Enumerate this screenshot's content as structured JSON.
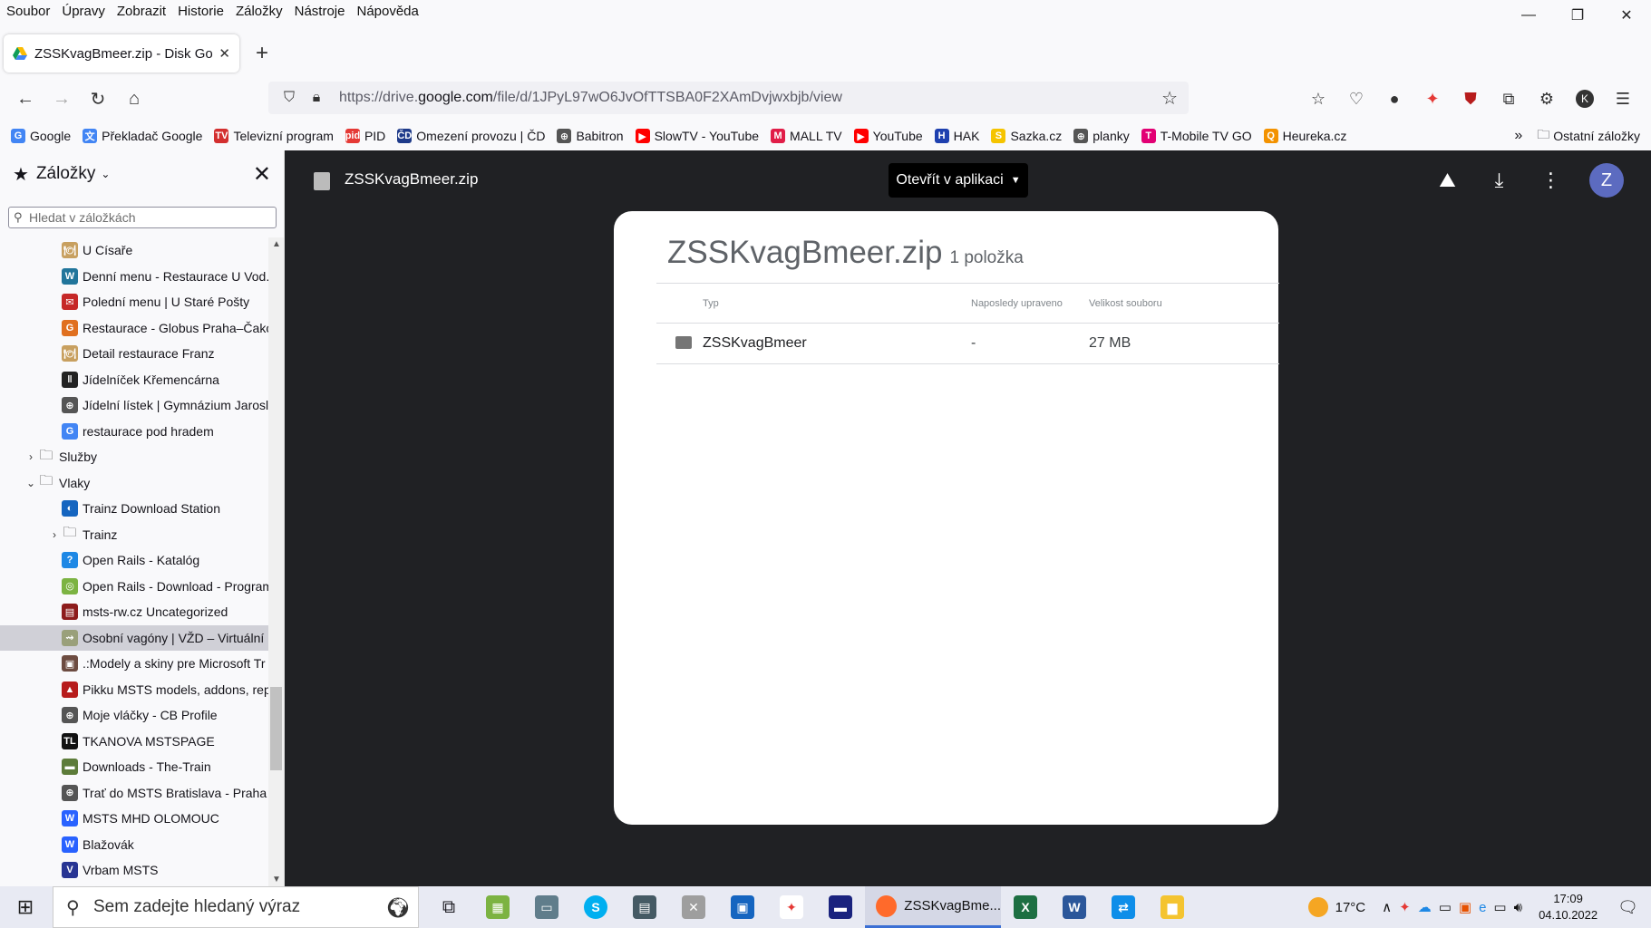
{
  "menubar": [
    "Soubor",
    "Úpravy",
    "Zobrazit",
    "Historie",
    "Záložky",
    "Nástroje",
    "Nápověda"
  ],
  "tab": {
    "title": "ZSSKvagBmeer.zip - Disk Googl",
    "close": "✕",
    "new": "+"
  },
  "url": {
    "prefix": "https://drive.",
    "domain": "google.com",
    "path": "/file/d/1JPyL97wO6JvOfTTSBA0F2XAmDvjwxbjb/view"
  },
  "bookmarks": [
    {
      "label": "Google",
      "color": "#4285f4",
      "glyph": "G"
    },
    {
      "label": "Překladač Google",
      "color": "#4285f4",
      "glyph": "文"
    },
    {
      "label": "Televizní program",
      "color": "#d32f2f",
      "glyph": "TV"
    },
    {
      "label": "PID",
      "color": "#e53935",
      "glyph": "pid"
    },
    {
      "label": "Omezení provozu | ČD",
      "color": "#1e3a8a",
      "glyph": "ČD"
    },
    {
      "label": "Babitron",
      "color": "#555555",
      "glyph": "⊕"
    },
    {
      "label": "SlowTV - YouTube",
      "color": "#ff0000",
      "glyph": "▶"
    },
    {
      "label": "MALL TV",
      "color": "#e11d48",
      "glyph": "M"
    },
    {
      "label": "YouTube",
      "color": "#ff0000",
      "glyph": "▶"
    },
    {
      "label": "HAK",
      "color": "#1e40af",
      "glyph": "H"
    },
    {
      "label": "Sazka.cz",
      "color": "#f5c400",
      "glyph": "S"
    },
    {
      "label": "planky",
      "color": "#555555",
      "glyph": "⊕"
    },
    {
      "label": "T-Mobile TV GO",
      "color": "#e20074",
      "glyph": "T"
    },
    {
      "label": "Heureka.cz",
      "color": "#f39200",
      "glyph": "Q"
    }
  ],
  "bookmarks_other": "Ostatní záložky",
  "sidebar": {
    "title": "Záložky",
    "search_placeholder": "Hledat v záložkách",
    "items": [
      {
        "label": "U Císaře",
        "indent": 2,
        "icon": "🍽",
        "color": "#c8a060"
      },
      {
        "label": "Denní menu - Restaurace U Vod...",
        "indent": 2,
        "icon": "W",
        "color": "#21759b"
      },
      {
        "label": "Polední menu | U Staré Pošty",
        "indent": 2,
        "icon": "✉",
        "color": "#c62828"
      },
      {
        "label": "Restaurace - Globus Praha–Čakovice",
        "indent": 2,
        "icon": "G",
        "color": "#e07020"
      },
      {
        "label": "Detail restaurace Franz",
        "indent": 2,
        "icon": "🍽",
        "color": "#c8a060"
      },
      {
        "label": "Jídelníček Křemencárna",
        "indent": 2,
        "icon": "ǁ",
        "color": "#222222"
      },
      {
        "label": "Jídelní lístek | Gymnázium Jaroslav",
        "indent": 2,
        "icon": "⊕",
        "color": "#555555"
      },
      {
        "label": "restaurace pod hradem",
        "indent": 2,
        "icon": "G",
        "color": "#4285f4"
      },
      {
        "label": "Služby",
        "indent": 1,
        "folder": true,
        "open": false
      },
      {
        "label": "Vlaky",
        "indent": 1,
        "folder": true,
        "open": true
      },
      {
        "label": "Trainz Download Station",
        "indent": 2,
        "icon": "◐",
        "color": "#1565c0"
      },
      {
        "label": "Trainz",
        "indent": 2,
        "folder": true,
        "open": false
      },
      {
        "label": "Open Rails - Katalóg",
        "indent": 2,
        "icon": "?",
        "color": "#1e88e5"
      },
      {
        "label": "Open Rails - Download - Program",
        "indent": 2,
        "icon": "◎",
        "color": "#7cb342"
      },
      {
        "label": "msts-rw.cz Uncategorized",
        "indent": 2,
        "icon": "▤",
        "color": "#8d1c1c"
      },
      {
        "label": "Osobní vagóny | VŽD – Virtuální",
        "indent": 2,
        "icon": "⇝",
        "color": "#9aa07a",
        "selected": true
      },
      {
        "label": ".:Modely a skiny pre Microsoft Tr",
        "indent": 2,
        "icon": "▣",
        "color": "#6d4c41"
      },
      {
        "label": "Pikku MSTS models, addons, rep",
        "indent": 2,
        "icon": "▲",
        "color": "#b71c1c"
      },
      {
        "label": "Moje vláčky - CB Profile",
        "indent": 2,
        "icon": "⊕",
        "color": "#555555"
      },
      {
        "label": "TKANOVA MSTSPAGE",
        "indent": 2,
        "icon": "TL",
        "color": "#111111"
      },
      {
        "label": "Downloads - The-Train",
        "indent": 2,
        "icon": "▬",
        "color": "#5d7c3a"
      },
      {
        "label": "Trať do MSTS Bratislava - Praha",
        "indent": 2,
        "icon": "⊕",
        "color": "#555555"
      },
      {
        "label": "MSTS MHD OLOMOUC",
        "indent": 2,
        "icon": "W",
        "color": "#2962ff"
      },
      {
        "label": "Blažovák",
        "indent": 2,
        "icon": "W",
        "color": "#2962ff"
      },
      {
        "label": "Vrbam MSTS",
        "indent": 2,
        "icon": "V",
        "color": "#283593"
      }
    ]
  },
  "viewer": {
    "filename": "ZSSKvagBmeer.zip",
    "open_button": "Otevřít v aplikaci",
    "avatar": "Z",
    "card_title": "ZSSKvagBmeer.zip",
    "card_count": "1 položka",
    "columns": {
      "type": "Typ",
      "modified": "Naposledy upraveno",
      "size": "Velikost souboru"
    },
    "rows": [
      {
        "name": "ZSSKvagBmeer",
        "modified": "-",
        "size": "27 MB"
      }
    ]
  },
  "taskbar": {
    "search_placeholder": "Sem zadejte hledaný výraz",
    "firefox_label": "ZSSKvagBme...",
    "temperature": "17°C",
    "time": "17:09",
    "date": "04.10.2022"
  },
  "colors": {
    "viewer_bg": "#202124",
    "accent": "#5c6bc0",
    "selected": "#d0d0d7"
  }
}
